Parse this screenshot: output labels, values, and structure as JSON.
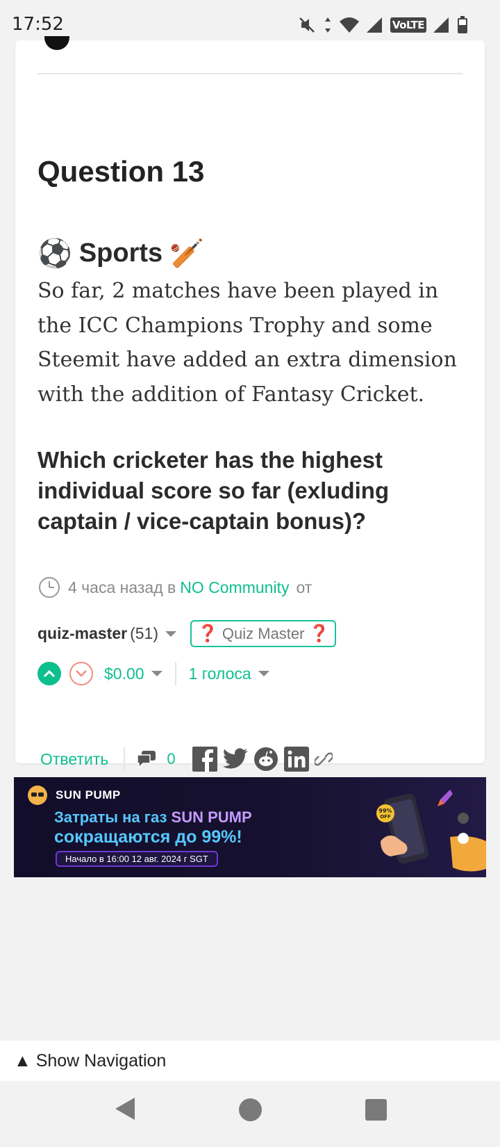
{
  "status_bar": {
    "time": "17:52",
    "volte_label": "VoLTE"
  },
  "post": {
    "title": "Question 13",
    "category": {
      "label": "Sports",
      "left_emoji": "⚽",
      "right_emoji": "🏏"
    },
    "body": "So far, 2 matches have been played in the ICC Champions Trophy and some Steemit have added an extra dimension with the addition of Fantasy Cricket.",
    "question": "Which cricketer has the highest individual score so far (exluding captain / vice-captain bonus)?",
    "meta": {
      "time_ago": "4 часа назад в",
      "community": "NO Community",
      "by": "от"
    },
    "author": {
      "name": "quiz-master",
      "reputation": "(51)",
      "badge_left": "❓",
      "badge_text": "Quiz Master",
      "badge_right": "❓"
    },
    "votes": {
      "payout": "$0.00",
      "count_label": "1 голоса"
    },
    "actions": {
      "reply_label": "Ответить",
      "comment_count": "0"
    }
  },
  "banner": {
    "brand": "SUN PUMP",
    "headline_part1": "Затраты на газ",
    "headline_brand": "SUN PUMP",
    "headline_line2": "сокращаются до 99%!",
    "date_text": "Начало в 16:00 12 авг. 2024 г SGT",
    "discount_badge": "99% OFF"
  },
  "navigation": {
    "show_nav_label": "▲ Show Navigation"
  },
  "colors": {
    "accent": "#0ebf8e",
    "downvote": "#f28b82",
    "badge_border": "#15c39a",
    "banner_bg": "#120d2a"
  }
}
